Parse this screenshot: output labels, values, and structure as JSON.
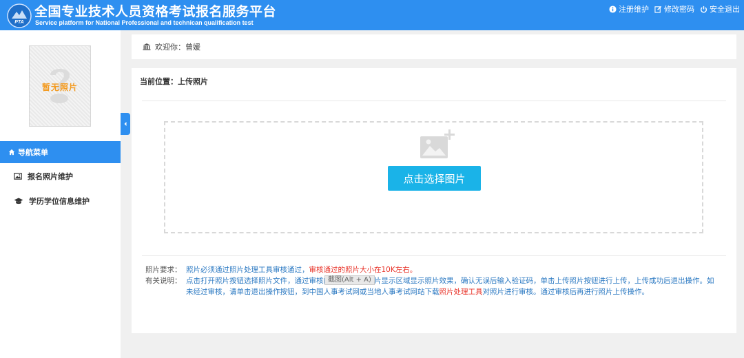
{
  "header": {
    "logo_text": "PTA",
    "title_cn": "全国专业技术人员资格考试报名服务平台",
    "title_en": "Service platform for National Professional and technican qualification test",
    "links": [
      {
        "label": "注册维护",
        "icon": "info-circle-icon"
      },
      {
        "label": "修改密码",
        "icon": "edit-icon"
      },
      {
        "label": "安全退出",
        "icon": "power-icon"
      }
    ]
  },
  "sidebar": {
    "photo_placeholder": "暂无照片",
    "nav_header": "导航菜单",
    "items": [
      {
        "label": "报名照片维护",
        "icon": "image-icon"
      },
      {
        "label": "学历学位信息维护",
        "icon": "graduation-cap-icon"
      }
    ]
  },
  "welcome": {
    "text": "欢迎你：曾媛",
    "icon": "bank-icon"
  },
  "main": {
    "breadcrumb": "当前位置：上传照片",
    "upload_button": "点击选择图片",
    "notes": {
      "req_label": "照片要求：",
      "req_text": "照片必须通过照片处理工具审核通过，",
      "req_red": "审核通过的照片大小在10K左右。",
      "desc_label": "有关说明：",
      "desc_text_1": "点击打开照片按钮选择照片文件，通过审核的照片可以在照片显示区域显示照片效果，确认无误后输入验证码，单击上传照片按钮进行上传，上传成功后退出操作。如未经过审核，请单击退出操作按钮，到中国人事考试网或当地人事考试网站下载",
      "desc_red": "照片处理工具",
      "desc_text_2": "对照片进行审核。通过审核后再进行照片上传操作。"
    },
    "tooltip": "截图(Alt + A)"
  },
  "colors": {
    "header_bg": "#2e8ff0",
    "button_bg": "#1ab3e8",
    "note_blue": "#2a78c2",
    "note_red": "#e8352b",
    "placeholder_orange": "#f39a1f"
  }
}
